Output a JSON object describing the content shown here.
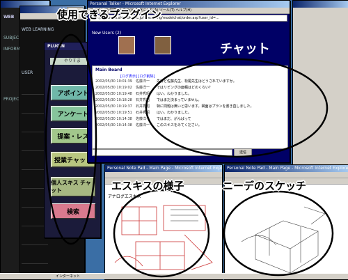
{
  "annotations": {
    "plugins_caption": "使用できるプラグイン",
    "esquisse_caption": "エスキスの様子",
    "other_caption": "ニーデのスケッチ"
  },
  "dark_window": {
    "tag": "WEB",
    "items": [
      "SUBJEC",
      "INFORM",
      "PROJEC"
    ]
  },
  "mid_window": {
    "header": "WEB LEARNING",
    "user_label": "USER"
  },
  "plugin_window": {
    "header": "PLUGIN",
    "top_item": "やりすま",
    "buttons": [
      {
        "label": "アポイント",
        "color": "#6fb7a9"
      },
      {
        "label": "アンケート",
        "color": "#86c49b"
      },
      {
        "label": "提案・レス",
        "color": "#a2c78b"
      },
      {
        "label": "授業チャット",
        "color": "#b8c680"
      },
      {
        "label": "個人スキス チャット",
        "color": "#a7b882"
      },
      {
        "label": "検索",
        "color": "#d97a8e"
      }
    ]
  },
  "chat_window": {
    "title": "Personal Talker - Microsoft Internet Explorer",
    "menu": "ファイル(F) 編集(E) 表示(V) お気に入り(A) ツール(T) ヘルプ(H)",
    "address": "http://sakuraeo.shizuoka.ac.jp/e-learning/modelchat/order.asp?user_id=...",
    "new_users": "New Users (2)",
    "chat_title": "チャット",
    "board_label": "Main Board",
    "links": "[ログ表示] [ログ削除]",
    "rows": [
      {
        "time": "2002/05/30 10:01:39",
        "user": "佐藤洋一",
        "text": "先ほど佐藤先生、松尾先生はどうされていますか。"
      },
      {
        "time": "2002/05/30 10:19:02",
        "user": "佐藤洋一",
        "text": "ではリビングの面積はどのくらい？"
      },
      {
        "time": "2002/05/30 10:19:48",
        "user": "石井秀昭",
        "text": "はい。わかりました。"
      },
      {
        "time": "2002/05/30 10:18:28",
        "user": "石井秀昭",
        "text": "ではまだ決まっていません。"
      },
      {
        "time": "2002/05/30 10:19:37",
        "user": "石井秀昭",
        "text": "特に問題は無いと思います。図面はプランを書き直しました。"
      },
      {
        "time": "2002/05/30 10:19:51",
        "user": "石井秀昭",
        "text": "はい。わかりました。"
      },
      {
        "time": "2002/05/30 10:14:38",
        "user": "佐藤洋一",
        "text": "ではまだ、がんばって"
      },
      {
        "time": "2002/05/30 10:14:38",
        "user": "佐藤洋一",
        "text": "このスキスをみてください。"
      }
    ],
    "send_label": "送信"
  },
  "sketch_left": {
    "title": "Personal Note Pad - Main Page - Microsoft Internet Explorer",
    "label": "アナログエスキス"
  },
  "sketch_right": {
    "title": "Personal Note Pad - Main Page - Microsoft Internet Explorer"
  },
  "taskbar": {
    "status": "インターネット"
  }
}
